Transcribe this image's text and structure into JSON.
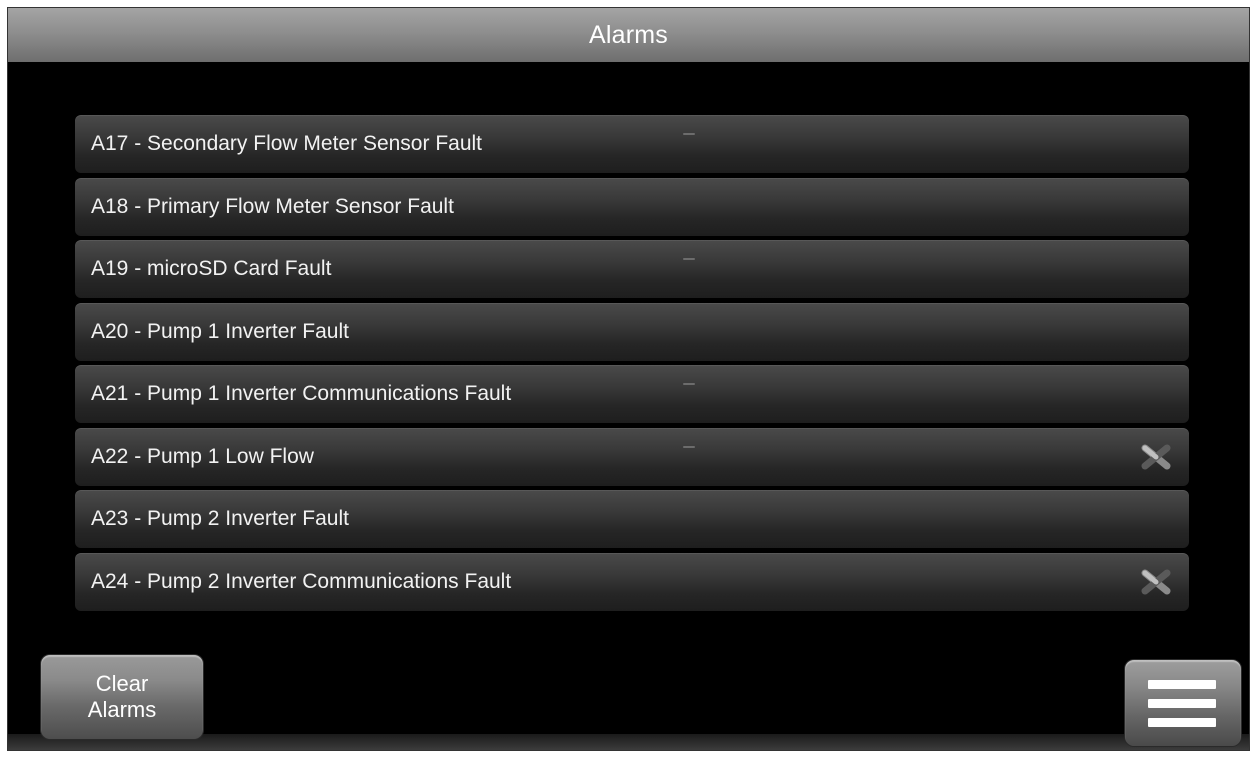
{
  "header": {
    "title": "Alarms"
  },
  "alarms": [
    {
      "label": "A17 - Secondary Flow Meter Sensor Fault",
      "dismissable": false
    },
    {
      "label": "A18 - Primary Flow Meter Sensor Fault",
      "dismissable": false
    },
    {
      "label": "A19 - microSD Card Fault",
      "dismissable": false
    },
    {
      "label": "A20 - Pump 1 Inverter Fault",
      "dismissable": false
    },
    {
      "label": "A21 - Pump 1 Inverter Communications Fault",
      "dismissable": false
    },
    {
      "label": "A22 - Pump 1 Low Flow",
      "dismissable": true
    },
    {
      "label": "A23 - Pump 2 Inverter Fault",
      "dismissable": false
    },
    {
      "label": "A24 - Pump 2 Inverter Communications Fault",
      "dismissable": true
    }
  ],
  "footer": {
    "clear_line1": "Clear",
    "clear_line2": "Alarms",
    "menu_icon": "hamburger-menu-icon"
  },
  "colors": {
    "background": "#000000",
    "header": "#8e8e8e",
    "row": "#333333",
    "text": "#f2f2f2"
  }
}
